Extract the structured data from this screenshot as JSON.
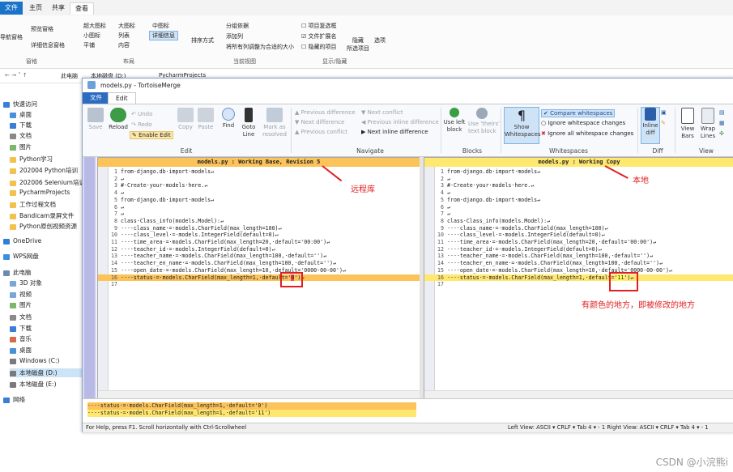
{
  "explorer": {
    "tabs": [
      "文件",
      "主页",
      "共享",
      "查看"
    ],
    "ribbon": {
      "pane_items": [
        "导航窗格",
        "预览窗格",
        "详细信息窗格"
      ],
      "layout_items": [
        "超大图标",
        "大图标",
        "中图标",
        "小图标",
        "列表",
        "详细信息",
        "平铺",
        "内容"
      ],
      "sort_label": "排序方式",
      "view_items": [
        "分组依据",
        "添加列",
        "将所有列调整为合适的大小"
      ],
      "show_items": [
        "项目复选框",
        "文件扩展名",
        "隐藏的项目"
      ],
      "hide_label": "隐藏\n所选项目",
      "options_label": "选项",
      "groups": [
        "窗格",
        "布局",
        "当前视图",
        "显示/隐藏"
      ]
    },
    "address": [
      "此电脑",
      "本地磁盘 (D:)",
      "PycharmProjects"
    ],
    "nav": [
      "快速访问",
      "桌面",
      "下载",
      "文档",
      "图片",
      "Python学习",
      "202004 Python培训",
      "202006 Selenium培训",
      "PycharmProjects",
      "工作过程文档",
      "Bandicam录屏文件",
      "Python原创视频资源",
      "OneDrive",
      "WPS网盘",
      "此电脑",
      "3D 对象",
      "视频",
      "图片",
      "文档",
      "下载",
      "音乐",
      "桌面",
      "Windows (C:)",
      "本地磁盘 (D:)",
      "本地磁盘 (E:)",
      "网络"
    ]
  },
  "merge": {
    "title": "models.py - TortoiseMerge",
    "tabs": [
      "文件",
      "Edit"
    ],
    "toolbar": {
      "save": "Save",
      "reload": "Reload",
      "undo": "Undo",
      "redo": "Redo",
      "enable_edit": "Enable Edit",
      "copy": "Copy",
      "paste": "Paste",
      "find": "Find",
      "goto": "Goto\nLine",
      "mark": "Mark as\nresolved",
      "prev_diff": "Previous difference",
      "next_diff": "Next difference",
      "prev_conflict": "Previous conflict",
      "next_conflict": "Next conflict",
      "prev_inline": "Previous inline difference",
      "next_inline": "Next inline difference",
      "use_left": "Use left\nblock",
      "use_theirs": "Use 'theirs'\ntext block",
      "show_ws": "Show\nWhitespaces",
      "compare_ws": "Compare whitespaces",
      "ignore_ws": "Ignore whitespace changes",
      "ignore_all_ws": "Ignore all whitespace changes",
      "inline_diff": "Inline\ndiff",
      "view_bars": "View\nBars",
      "wrap_lines": "Wrap\nLines",
      "groups": [
        "Edit",
        "Navigate",
        "Blocks",
        "Whitespaces",
        "Diff",
        "View"
      ]
    },
    "left_header": "models.py : Working Base, Revision 5",
    "right_header": "models.py : Working Copy",
    "lines": [
      {
        "n": "1",
        "t": "from·django.db·import·models↵"
      },
      {
        "n": "2",
        "t": "↵"
      },
      {
        "n": "3",
        "t": "#·Create·your·models·here.↵"
      },
      {
        "n": "4",
        "t": "↵"
      },
      {
        "n": "5",
        "t": "from·django.db·import·models↵"
      },
      {
        "n": "6",
        "t": "↵"
      },
      {
        "n": "7",
        "t": "↵"
      },
      {
        "n": "8",
        "t": "class·Class_info(models.Model):↵"
      },
      {
        "n": "9",
        "t": "····class_name·=·models.CharField(max_length=100)↵"
      },
      {
        "n": "10",
        "t": "····class_level·=·models.IntegerField(default=0)↵"
      },
      {
        "n": "11",
        "t": "····time_area·=·models.CharField(max_length=20,·default='00:00')↵"
      },
      {
        "n": "12",
        "t": "····teacher_id·=·models.IntegerField(default=0)↵"
      },
      {
        "n": "13",
        "t": "····teacher_name·=·models.CharField(max_length=100,·default='')↵"
      },
      {
        "n": "14",
        "t": "····teacher_en_name·=·models.CharField(max_length=100,·default='')↵"
      },
      {
        "n": "15",
        "t": "····open_date·=·models.CharField(max_length=10,·default='0000-00-00')↵"
      }
    ],
    "left_line16_prefix": "····status·=·models.CharField(max_length=1,·default='",
    "left_line16_hl": "0",
    "left_line16_suffix": "')↵",
    "right_line16_prefix": "····status·=·models.CharField(max_length=1,·default='",
    "right_line16_hl": "11",
    "right_line16_suffix": "')↵",
    "line16": "16",
    "line17": "17",
    "bottom_line1": "····status·=·models.CharField(max_length=1,·default='0')",
    "bottom_line2": "····status·=·models.CharField(max_length=1,·default='11')",
    "status_left": "For Help, press F1. Scroll horizontally with Ctrl-Scrollwheel",
    "status_right": "Left View:  ASCII  ▾  CRLF  ▾  Tab 4  ▾  - 1    Right View:  ASCII  ▾  CRLF  ▾  Tab 4  ▾  - 1"
  },
  "annotations": {
    "remote": "远程库",
    "local": "本地",
    "note": "有颜色的地方，即被修改的地方"
  },
  "watermark": "CSDN @小浣熊i"
}
